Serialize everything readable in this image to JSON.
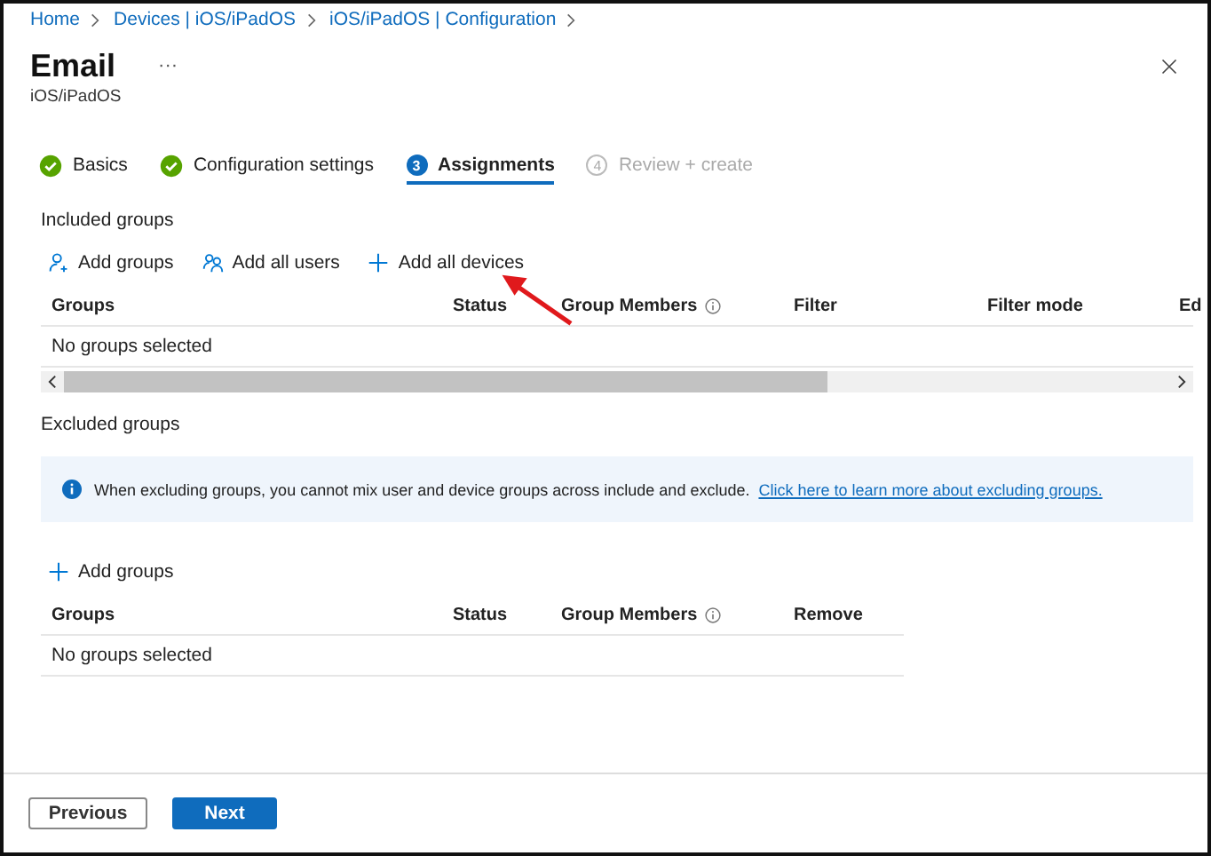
{
  "breadcrumbs": [
    "Home",
    "Devices | iOS/iPadOS",
    "iOS/iPadOS | Configuration"
  ],
  "page": {
    "title": "Email",
    "more": "···",
    "subtitle": "iOS/iPadOS"
  },
  "steps": [
    {
      "label": "Basics",
      "kind": "done",
      "selected": false
    },
    {
      "label": "Configuration settings",
      "kind": "done",
      "selected": false
    },
    {
      "label": "Assignments",
      "kind": "current",
      "number": "3",
      "selected": true
    },
    {
      "label": "Review + create",
      "kind": "pending",
      "number": "4",
      "selected": false
    }
  ],
  "included": {
    "title": "Included groups",
    "actions": [
      {
        "kind": "add-group",
        "label": "Add groups"
      },
      {
        "kind": "add-users",
        "label": "Add all users"
      },
      {
        "kind": "plus",
        "label": "Add all devices"
      }
    ],
    "columns": [
      {
        "label": "Groups",
        "info": false
      },
      {
        "label": "Status",
        "info": false
      },
      {
        "label": "Group Members",
        "info": true
      },
      {
        "label": "Filter",
        "info": false
      },
      {
        "label": "Filter mode",
        "info": false
      },
      {
        "label": "Ed",
        "info": false
      }
    ],
    "empty": "No groups selected"
  },
  "excluded": {
    "title": "Excluded groups",
    "info": {
      "text": "When excluding groups, you cannot mix user and device groups across include and exclude.",
      "link": "Click here to learn more about excluding groups."
    },
    "actions": [
      {
        "kind": "plus",
        "label": "Add groups"
      }
    ],
    "columns": [
      {
        "label": "Groups",
        "info": false
      },
      {
        "label": "Status",
        "info": false
      },
      {
        "label": "Group Members",
        "info": true
      },
      {
        "label": "Remove",
        "info": false
      }
    ],
    "empty": "No groups selected"
  },
  "buttons": [
    {
      "label": "Previous",
      "kind": "secondary"
    },
    {
      "label": "Next",
      "kind": "primary"
    }
  ]
}
